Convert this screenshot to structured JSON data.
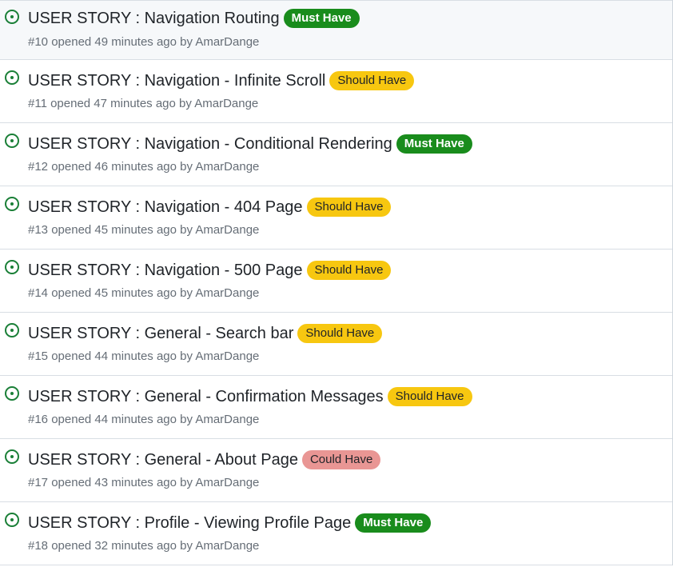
{
  "colors": {
    "open_icon": "#1a7f37",
    "must_have": "#198c1c",
    "should_have": "#f7c710",
    "could_have": "#e99694"
  },
  "issues": [
    {
      "title": "USER STORY : Navigation Routing",
      "label": "Must Have",
      "priority": "must",
      "meta_prefix": "#10 opened 49 minutes ago by",
      "author": "AmarDange"
    },
    {
      "title": "USER STORY : Navigation - Infinite Scroll",
      "label": "Should Have",
      "priority": "should",
      "meta_prefix": "#11 opened 47 minutes ago by",
      "author": "AmarDange"
    },
    {
      "title": "USER STORY : Navigation - Conditional Rendering",
      "label": "Must Have",
      "priority": "must",
      "meta_prefix": "#12 opened 46 minutes ago by",
      "author": "AmarDange"
    },
    {
      "title": "USER STORY : Navigation - 404 Page",
      "label": "Should Have",
      "priority": "should",
      "meta_prefix": "#13 opened 45 minutes ago by",
      "author": "AmarDange"
    },
    {
      "title": "USER STORY : Navigation - 500 Page",
      "label": "Should Have",
      "priority": "should",
      "meta_prefix": "#14 opened 45 minutes ago by",
      "author": "AmarDange"
    },
    {
      "title": "USER STORY : General - Search bar",
      "label": "Should Have",
      "priority": "should",
      "meta_prefix": "#15 opened 44 minutes ago by",
      "author": "AmarDange"
    },
    {
      "title": "USER STORY : General - Confirmation Messages",
      "label": "Should Have",
      "priority": "should",
      "meta_prefix": "#16 opened 44 minutes ago by",
      "author": "AmarDange"
    },
    {
      "title": "USER STORY : General - About Page",
      "label": "Could Have",
      "priority": "could",
      "meta_prefix": "#17 opened 43 minutes ago by",
      "author": "AmarDange"
    },
    {
      "title": "USER STORY : Profile - Viewing Profile Page",
      "label": "Must Have",
      "priority": "must",
      "meta_prefix": "#18 opened 32 minutes ago by",
      "author": "AmarDange"
    }
  ]
}
